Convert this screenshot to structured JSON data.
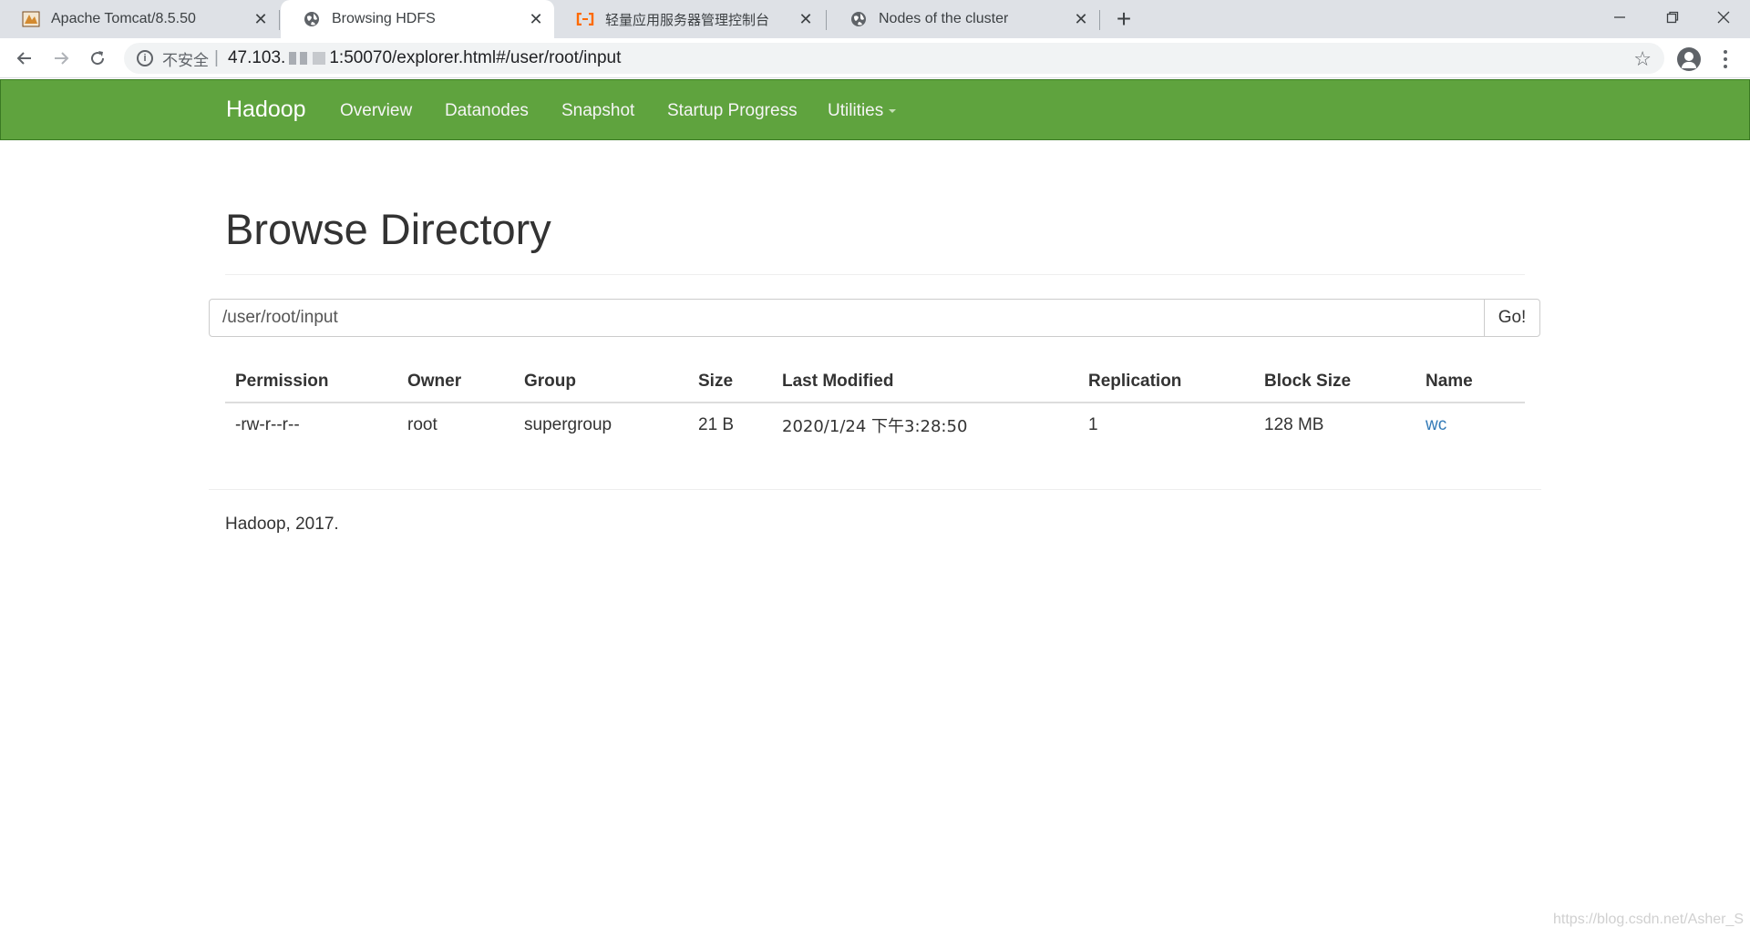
{
  "browser": {
    "tabs": [
      {
        "title": "Apache Tomcat/8.5.50",
        "icon": "tomcat-icon",
        "active": false
      },
      {
        "title": "Browsing HDFS",
        "icon": "globe-icon",
        "active": true
      },
      {
        "title": "轻量应用服务器管理控制台",
        "icon": "aliyun-icon",
        "active": false
      },
      {
        "title": "Nodes of the cluster",
        "icon": "globe-icon",
        "active": false
      }
    ],
    "new_tab_label": "+",
    "close_label": "✕",
    "security_label": "不安全",
    "url_prefix": "47.103.",
    "url_suffix": "1:50070/explorer.html#/user/root/input"
  },
  "navbar": {
    "brand": "Hadoop",
    "items": [
      "Overview",
      "Datanodes",
      "Snapshot",
      "Startup Progress",
      "Utilities"
    ],
    "color": "#5fa33e"
  },
  "main": {
    "title": "Browse Directory",
    "path_value": "/user/root/input",
    "go_label": "Go!",
    "columns": [
      "Permission",
      "Owner",
      "Group",
      "Size",
      "Last Modified",
      "Replication",
      "Block Size",
      "Name"
    ],
    "rows": [
      {
        "permission": "-rw-r--r--",
        "owner": "root",
        "group": "supergroup",
        "size": "21 B",
        "last_modified": "2020/1/24 下午3:28:50",
        "replication": "1",
        "block_size": "128 MB",
        "name": "wc"
      }
    ]
  },
  "footer": {
    "text": "Hadoop, 2017."
  },
  "watermark": "https://blog.csdn.net/Asher_S"
}
